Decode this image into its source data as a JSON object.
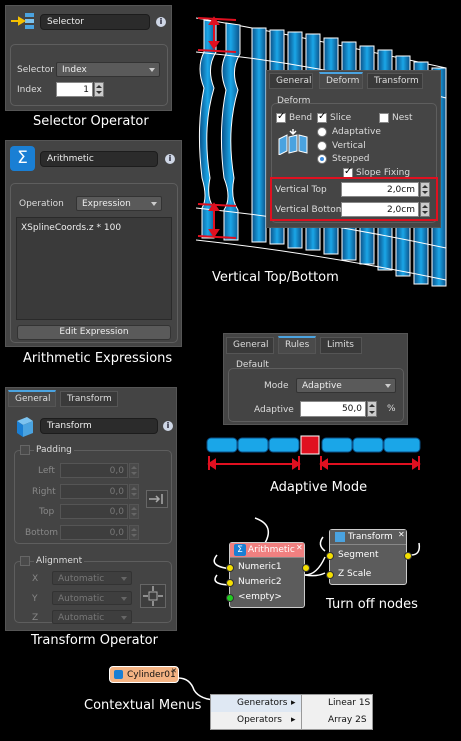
{
  "selector": {
    "title": "Selector",
    "selector_label": "Selector",
    "selector_value": "Index",
    "index_label": "Index",
    "index_value": "1",
    "caption": "Selector Operator"
  },
  "arithmetic": {
    "title": "Arithmetic",
    "operation_label": "Operation",
    "operation_value": "Expression",
    "expression": "XSplineCoords.z * 100",
    "edit_button": "Edit Expression",
    "caption": "Arithmetic Expressions"
  },
  "deform": {
    "tabs": [
      "General",
      "Deform",
      "Transform"
    ],
    "group_label": "Deform",
    "bend": "Bend",
    "slice": "Slice",
    "nest": "Nest",
    "adaptative": "Adaptative",
    "vertical": "Vertical",
    "stepped": "Stepped",
    "slope_fixing": "Slope Fixing",
    "vertical_top_label": "Vertical Top",
    "vertical_top_value": "2,0cm",
    "vertical_bottom_label": "Vertical Bottom",
    "vertical_bottom_value": "2,0cm",
    "caption": "Vertical Top/Bottom"
  },
  "rules": {
    "tabs": [
      "General",
      "Rules",
      "Limits"
    ],
    "group_label": "Default",
    "mode_label": "Mode",
    "mode_value": "Adaptive",
    "adaptive_label": "Adaptive",
    "adaptive_value": "50,0",
    "unit": "%",
    "caption": "Adaptive Mode"
  },
  "transform": {
    "tabs": [
      "General",
      "Transform"
    ],
    "title": "Transform",
    "padding_label": "Padding",
    "left_label": "Left",
    "right_label": "Right",
    "top_label": "Top",
    "bottom_label": "Bottom",
    "zero_value": "0,0",
    "alignment_label": "Alignment",
    "x_label": "X",
    "y_label": "Y",
    "z_label": "Z",
    "automatic": "Automatic",
    "caption": "Transform Operator"
  },
  "nodes": {
    "arithmetic_title": "Arithmetic",
    "numeric1": "Numeric1",
    "numeric2": "Numeric2",
    "empty": "<empty>",
    "transform_title": "Transform",
    "segment": "Segment",
    "zscale": "Z Scale",
    "caption": "Turn off nodes"
  },
  "context": {
    "node_title": "Cylinder01",
    "generators": "Generators",
    "operators": "Operators",
    "linear": "Linear 1S",
    "array": "Array 2S",
    "caption": "Contextual Menus"
  },
  "colors": {
    "accent_blue": "#1aa6e8",
    "highlight_red": "#e01020",
    "node_yellow": "#f5e000",
    "panel_bg": "#444444"
  }
}
